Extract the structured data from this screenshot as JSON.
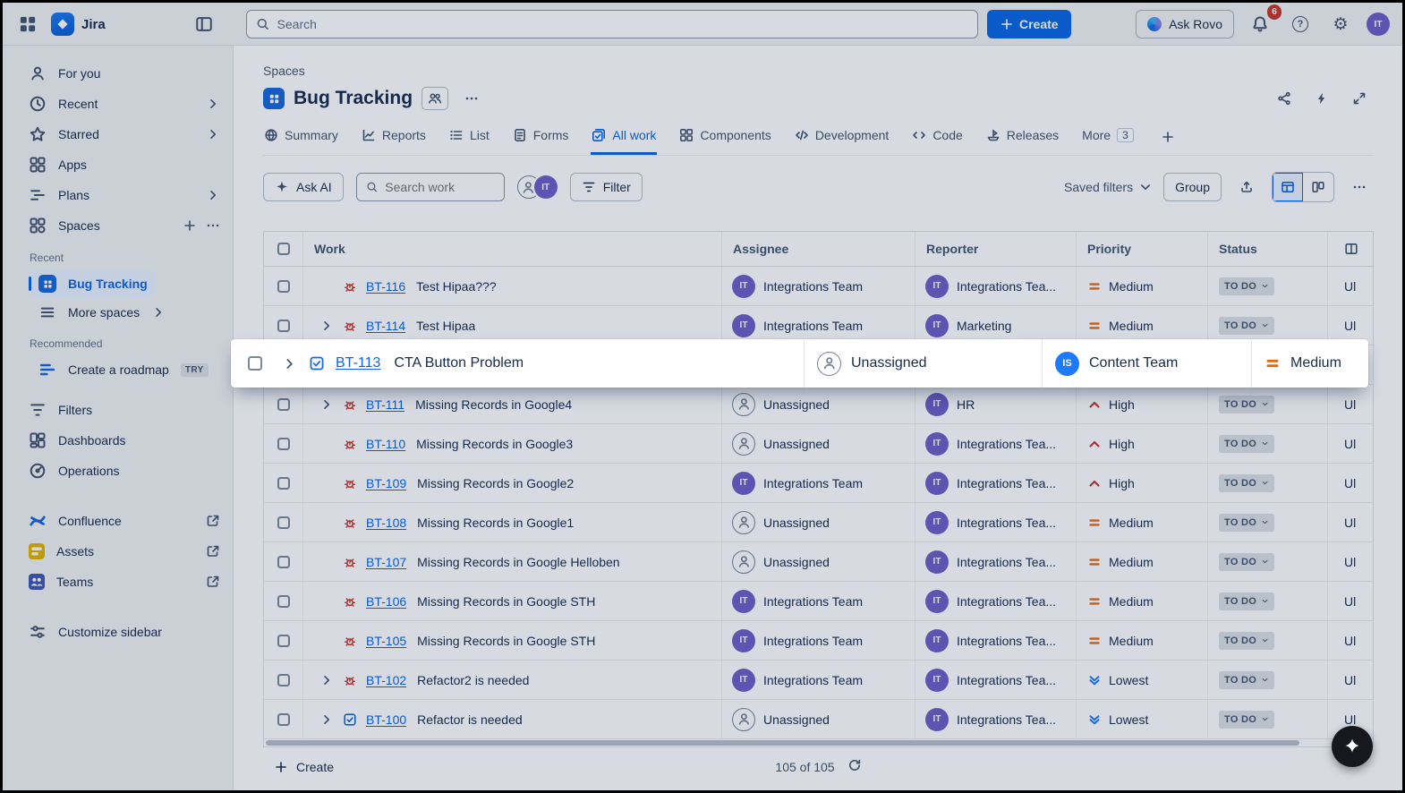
{
  "topbar": {
    "app_name": "Jira",
    "search_placeholder": "Search",
    "create_label": "Create",
    "ask_rovo_label": "Ask Rovo",
    "notification_count": "6",
    "avatar_initials": "IT"
  },
  "sidebar": {
    "items": [
      {
        "label": "For you"
      },
      {
        "label": "Recent"
      },
      {
        "label": "Starred"
      },
      {
        "label": "Apps"
      },
      {
        "label": "Plans"
      },
      {
        "label": "Spaces"
      }
    ],
    "recent_heading": "Recent",
    "bug_tracking_label": "Bug Tracking",
    "more_spaces_label": "More spaces",
    "recommended_heading": "Recommended",
    "create_roadmap_label": "Create a roadmap",
    "try_badge": "TRY",
    "filters_label": "Filters",
    "dashboards_label": "Dashboards",
    "operations_label": "Operations",
    "confluence_label": "Confluence",
    "assets_label": "Assets",
    "teams_label": "Teams",
    "customize_label": "Customize sidebar"
  },
  "page": {
    "breadcrumb": "Spaces",
    "title": "Bug Tracking",
    "tabs": [
      {
        "label": "Summary"
      },
      {
        "label": "Reports"
      },
      {
        "label": "List"
      },
      {
        "label": "Forms"
      },
      {
        "label": "All work"
      },
      {
        "label": "Components"
      },
      {
        "label": "Development"
      },
      {
        "label": "Code"
      },
      {
        "label": "Releases"
      },
      {
        "label": "More",
        "badge": "3"
      }
    ],
    "toolbar": {
      "ask_ai": "Ask AI",
      "search_placeholder": "Search work",
      "filter": "Filter",
      "saved_filters": "Saved filters",
      "group": "Group"
    }
  },
  "table": {
    "columns": {
      "work": "Work",
      "assignee": "Assignee",
      "reporter": "Reporter",
      "priority": "Priority",
      "status": "Status"
    },
    "status_label": "TO DO",
    "overflow_fragment": "Ul",
    "rows": [
      {
        "key": "BT-116",
        "summary": "Test Hipaa???",
        "type": "bug",
        "expand": false,
        "assignee": "Integrations Team",
        "assignee_avatar": "IT",
        "reporter": "Integrations Tea...",
        "reporter_avatar": "IT",
        "priority": "Medium"
      },
      {
        "key": "BT-114",
        "summary": "Test Hipaa",
        "type": "bug",
        "expand": true,
        "assignee": "Integrations Team",
        "assignee_avatar": "IT",
        "reporter": "Marketing",
        "reporter_avatar": "IT",
        "priority": "Medium"
      },
      {
        "spacer": true
      },
      {
        "key": "BT-111",
        "summary": "Missing Records in Google4",
        "type": "bug",
        "expand": true,
        "assignee": "Unassigned",
        "assignee_avatar": "",
        "reporter": "HR",
        "reporter_avatar": "IT",
        "priority": "High"
      },
      {
        "key": "BT-110",
        "summary": "Missing Records in Google3",
        "type": "bug",
        "expand": false,
        "assignee": "Unassigned",
        "assignee_avatar": "",
        "reporter": "Integrations Tea...",
        "reporter_avatar": "IT",
        "priority": "High"
      },
      {
        "key": "BT-109",
        "summary": "Missing Records in Google2",
        "type": "bug",
        "expand": false,
        "assignee": "Integrations Team",
        "assignee_avatar": "IT",
        "reporter": "Integrations Tea...",
        "reporter_avatar": "IT",
        "priority": "High"
      },
      {
        "key": "BT-108",
        "summary": "Missing Records in Google1",
        "type": "bug",
        "expand": false,
        "assignee": "Unassigned",
        "assignee_avatar": "",
        "reporter": "Integrations Tea...",
        "reporter_avatar": "IT",
        "priority": "Medium"
      },
      {
        "key": "BT-107",
        "summary": "Missing Records in Google Helloben",
        "type": "bug",
        "expand": false,
        "assignee": "Unassigned",
        "assignee_avatar": "",
        "reporter": "Integrations Tea...",
        "reporter_avatar": "IT",
        "priority": "Medium"
      },
      {
        "key": "BT-106",
        "summary": "Missing Records in Google STH",
        "type": "bug",
        "expand": false,
        "assignee": "Integrations Team",
        "assignee_avatar": "IT",
        "reporter": "Integrations Tea...",
        "reporter_avatar": "IT",
        "priority": "Medium"
      },
      {
        "key": "BT-105",
        "summary": "Missing Records in Google STH",
        "type": "bug",
        "expand": false,
        "assignee": "Integrations Team",
        "assignee_avatar": "IT",
        "reporter": "Integrations Tea...",
        "reporter_avatar": "IT",
        "priority": "Medium"
      },
      {
        "key": "BT-102",
        "summary": "Refactor2 is needed",
        "type": "bug",
        "expand": true,
        "assignee": "Integrations Team",
        "assignee_avatar": "IT",
        "reporter": "Integrations Tea...",
        "reporter_avatar": "IT",
        "priority": "Lowest"
      },
      {
        "key": "BT-100",
        "summary": "Refactor is needed",
        "type": "task",
        "expand": true,
        "assignee": "Unassigned",
        "assignee_avatar": "",
        "reporter": "Integrations Tea...",
        "reporter_avatar": "IT",
        "priority": "Lowest"
      }
    ],
    "footer": {
      "create": "Create",
      "count": "105 of 105"
    }
  },
  "drag_row": {
    "key": "BT-113",
    "summary": "CTA Button Problem",
    "assignee": "Unassigned",
    "reporter": "Content Team",
    "reporter_avatar": "IS",
    "priority": "Medium"
  },
  "colors": {
    "accent": "#0C66E4",
    "selected_bg": "#E9F2FF",
    "status_bg": "#DCDFE4"
  }
}
